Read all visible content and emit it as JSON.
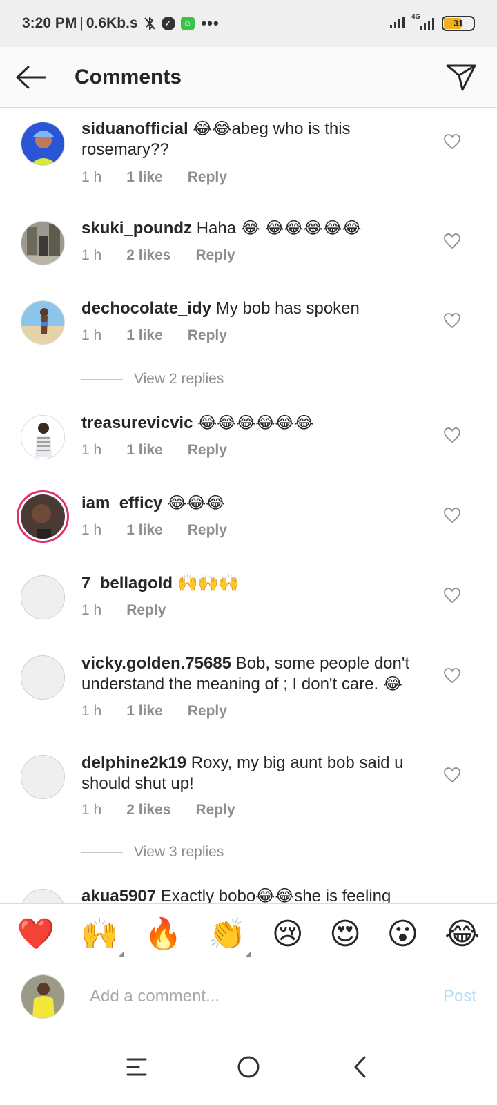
{
  "status_bar": {
    "time": "3:20 PM",
    "speed": "0.6Kb.s",
    "battery": "31",
    "network": "4G"
  },
  "header": {
    "title": "Comments"
  },
  "comments": [
    {
      "username": "siduanofficial",
      "text": " 😂😂abeg who is this rosemary??",
      "time": "1 h",
      "likes": "1 like",
      "reply": "Reply"
    },
    {
      "username": "skuki_poundz",
      "text": " Haha 😂 😂😂😂😂😂",
      "time": "1 h",
      "likes": "2 likes",
      "reply": "Reply"
    },
    {
      "username": "dechocolate_idy",
      "text": " My bob has spoken",
      "time": "1 h",
      "likes": "1 like",
      "reply": "Reply",
      "view_replies": "View 2 replies"
    },
    {
      "username": "treasurevicvic",
      "text": " 😂😂😂😂😂😂",
      "time": "1 h",
      "likes": "1 like",
      "reply": "Reply"
    },
    {
      "username": "iam_efficy",
      "text": " 😂😂😂",
      "time": "1 h",
      "likes": "1 like",
      "reply": "Reply"
    },
    {
      "username": "7_bellagold",
      "text": " 🙌🙌🙌",
      "time": "1 h",
      "reply": "Reply"
    },
    {
      "username": "vicky.golden.75685",
      "text": " Bob, some people don't understand the meaning of ; I don't care. 😂",
      "time": "1 h",
      "likes": "1 like",
      "reply": "Reply"
    },
    {
      "username": "delphine2k19",
      "text": " Roxy, my big aunt bob said u should shut up!",
      "time": "1 h",
      "likes": "2 likes",
      "reply": "Reply",
      "view_replies": "View 3 replies"
    },
    {
      "username": "akua5907",
      "text": " Exactly bobo😂😂she is feeling"
    }
  ],
  "emoji_bar": [
    "❤️",
    "🙌",
    "🔥",
    "👏",
    "😢",
    "😍",
    "😮",
    "😂"
  ],
  "input": {
    "placeholder": "Add a comment...",
    "post_label": "Post"
  },
  "colors": {
    "accent_light": "#b2dffc",
    "story_ring": "#e1306c",
    "meta_gray": "#8e8e8e"
  },
  "icons": {
    "back": "arrow-left-icon",
    "send": "paper-plane-icon",
    "heart": "heart-outline-icon"
  }
}
